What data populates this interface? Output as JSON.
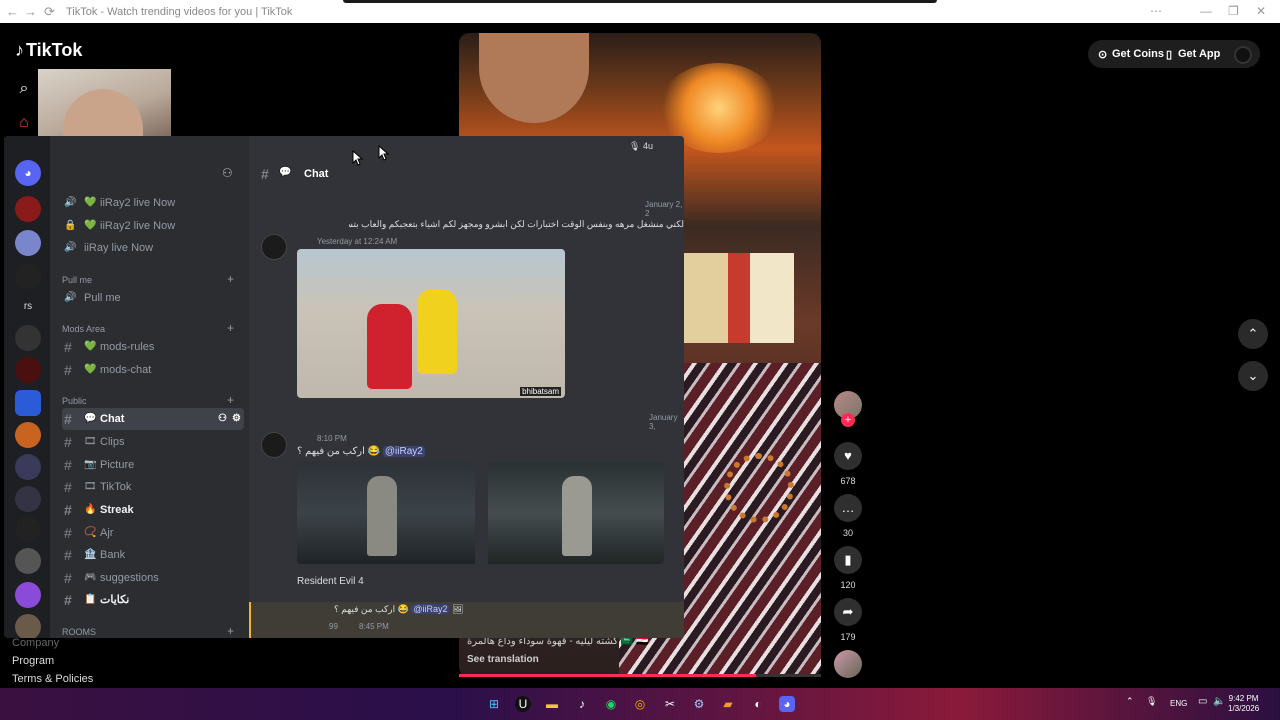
{
  "browser": {
    "title": "TikTok - Watch trending videos for you | TikTok",
    "back": "←",
    "forward": "→",
    "reload": "⟳",
    "more": "⋯",
    "minimize": "—",
    "restore": "❐",
    "close": "✕"
  },
  "tiktok": {
    "logo": "TikTok",
    "get_coins": "Get Coins",
    "get_app": "Get App",
    "footer": [
      "Company",
      "Program",
      "Terms & Policies"
    ],
    "caption": "كشته ليليه - قهوة سوداء وداع هالمرة 🇸🇦 🇪🇬",
    "see_translation": "See translation",
    "progress_fraction": 0.82,
    "actions": {
      "likes": "678",
      "comments": "30",
      "saves": "120",
      "shares": "179"
    }
  },
  "discord": {
    "user_count": "4u",
    "channel_title": "Chat",
    "voice_channels": [
      {
        "label": "iiRay2 live Now"
      },
      {
        "label": "iiRay2 live Now"
      },
      {
        "label": "iiRay live Now"
      }
    ],
    "categories": {
      "pull_me": "Pull me",
      "mods_area": "Mods Area",
      "public": "Public",
      "rooms": "ROOMS"
    },
    "pull_me_channel": "Pull me",
    "mods_channels": [
      "mods-rules",
      "mods-chat"
    ],
    "public_channels": [
      "Chat",
      "Clips",
      "Picture",
      "TikTok",
      "Streak",
      "Ajr",
      "Bank",
      "suggestions",
      "نكايات"
    ],
    "server_rs": "rs",
    "messages": {
      "date1": "January 2, 2",
      "reply1": "لكني منشغل مرهه وبنفس الوقت اختبارات لكن ابشرو ومجهز لكم اشياء بتعجبكم والعاب بتستمتعون فيها",
      "time1": "Yesterday at 12:24 AM",
      "watermark1": "bhibatsam",
      "date2": "January 3,",
      "time2": "8:10 PM",
      "text2": "اركب من فيهم ؟ 😂",
      "mention": "@iiRay2",
      "caption2": "Resident Evil 4",
      "reply3": "اركب من فيهم ؟ 😂",
      "time3": "8:45 PM",
      "badge": "99"
    }
  },
  "taskbar": {
    "lang": "ENG",
    "time": "9:42 PM",
    "date": "1/3/2026"
  }
}
